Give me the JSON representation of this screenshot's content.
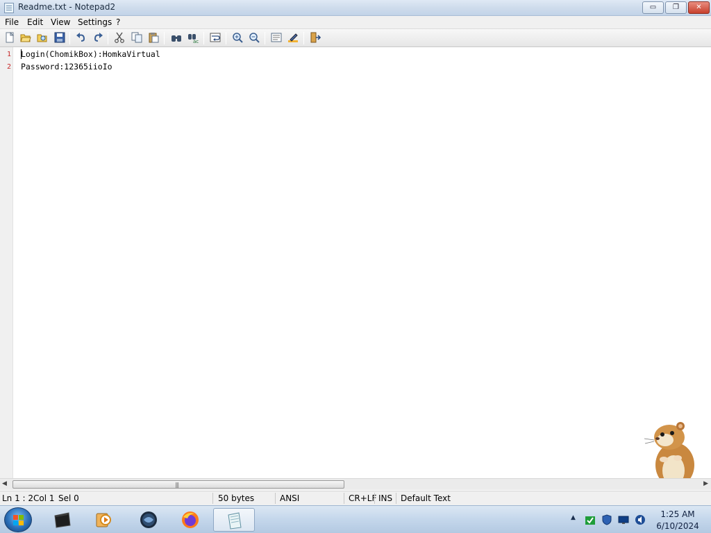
{
  "window": {
    "title": "Readme.txt - Notepad2",
    "controls": {
      "minimize": "▭",
      "maximize": "❐",
      "close": "✕"
    }
  },
  "menu": [
    "File",
    "Edit",
    "View",
    "Settings",
    "?"
  ],
  "toolbar": [
    "new-file-icon",
    "open-file-icon",
    "browse-icon",
    "save-icon",
    "undo-icon",
    "redo-icon",
    "cut-icon",
    "copy-icon",
    "paste-icon",
    "find-icon",
    "replace-icon",
    "word-wrap-icon",
    "zoom-in-icon",
    "zoom-out-icon",
    "scheme-icon",
    "customize-scheme-icon",
    "exit-icon"
  ],
  "editor": {
    "lines": [
      {
        "number": "1",
        "text": "Login(ChomikBox):HomkaVirtual"
      },
      {
        "number": "2",
        "text": "Password:12365iioIo"
      }
    ]
  },
  "scrollbar": {
    "left_arrow": "◀",
    "right_arrow": "▶",
    "grip": "|||"
  },
  "status": {
    "position": "Ln 1 : 2",
    "column": "Col 1",
    "selection": "Sel 0",
    "size": "50 bytes",
    "encoding": "ANSI",
    "line_endings": "CR+LF",
    "insert_mode": "INS",
    "scheme": "Default Text"
  },
  "taskbar": {
    "apps": [
      "terminal-app-icon",
      "media-player-icon",
      "app-icon",
      "firefox-icon",
      "notepad2-icon"
    ],
    "tray": {
      "show_hidden": "▲",
      "time": "1:25 AM",
      "date": "6/10/2024"
    }
  },
  "colors": {
    "line_number": "#c62828",
    "titlebar": "#cfdcec",
    "taskbar": "#c6d8ec"
  }
}
